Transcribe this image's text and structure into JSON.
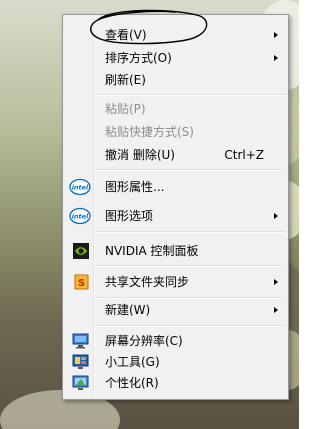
{
  "menu": {
    "items": [
      {
        "label": "查看(V)",
        "submenu": true
      },
      {
        "label": "排序方式(O)",
        "submenu": true
      },
      {
        "label": "刷新(E)"
      },
      {
        "label": "粘贴(P)",
        "disabled": true
      },
      {
        "label": "粘贴快捷方式(S)",
        "disabled": true
      },
      {
        "label": "撤消 删除(U)",
        "shortcut": "Ctrl+Z"
      },
      {
        "label": "图形属性...",
        "icon": "intel-logo-icon"
      },
      {
        "label": "图形选项",
        "icon": "intel-logo-icon",
        "submenu": true
      },
      {
        "label": "NVIDIA 控制面板",
        "icon": "nvidia-logo-icon"
      },
      {
        "label": "共享文件夹同步",
        "icon": "sync-icon",
        "submenu": true
      },
      {
        "label": "新建(W)",
        "submenu": true
      },
      {
        "label": "屏幕分辨率(C)",
        "icon": "display-icon"
      },
      {
        "label": "小工具(G)",
        "icon": "gadgets-icon"
      },
      {
        "label": "个性化(R)",
        "icon": "personalize-icon"
      }
    ]
  },
  "colors": {
    "menu_bg": "#f1f1f1",
    "disabled_text": "#8d8d8d",
    "intel_blue": "#0071c5",
    "nvidia_green": "#76b900",
    "annotation_ink": "#000000"
  }
}
